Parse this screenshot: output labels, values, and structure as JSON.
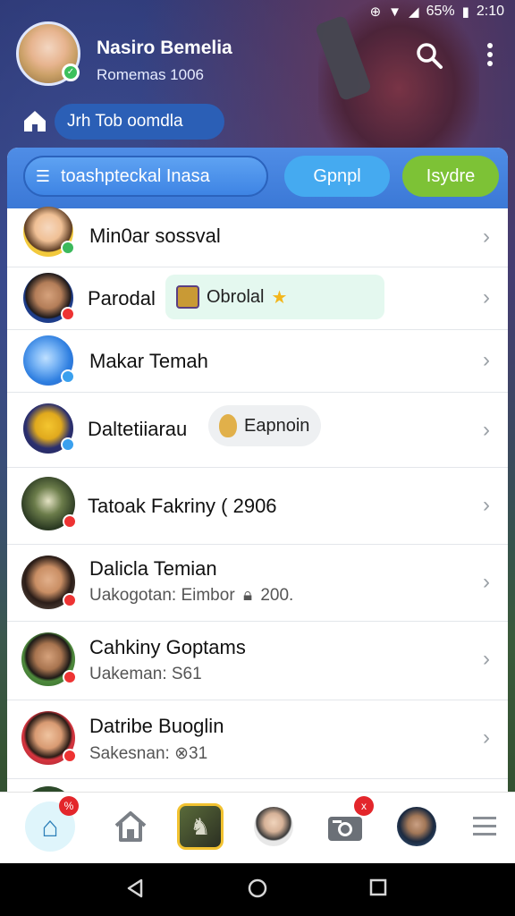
{
  "status": {
    "battery": "65%",
    "time": "2:10"
  },
  "header": {
    "user_name": "Nasiro Bemelia",
    "user_subtitle": "Romemas 1006",
    "chip_label": "Jrh Tob oomdla"
  },
  "toolbar": {
    "search_pill_label": "toashpteckal Inasa",
    "group_button": "Gpnpl",
    "share_button": "Isydre"
  },
  "rows": [
    {
      "title": "Min0ar sossval",
      "subtitle": ""
    },
    {
      "title": "Parodal",
      "tag": "Obrolal"
    },
    {
      "title": "Makar Temah",
      "subtitle": ""
    },
    {
      "title": "Daltetiiarau",
      "tag": "Eapnoin"
    },
    {
      "title": "Tatoak Fakriny ( 2906",
      "subtitle": ""
    },
    {
      "title": "Dalicla Temian",
      "subtitle": "Uakogotan: Eimbor",
      "subtitle_value": "200."
    },
    {
      "title": "Cahkiny Goptams",
      "subtitle": "Uakeman: S61"
    },
    {
      "title": "Datribe Buoglin",
      "subtitle": "Sakesnan: ",
      "subtitle_value": "31"
    }
  ],
  "bottom_nav": {
    "badge_first": "%",
    "badge_camera": "x"
  },
  "colors": {
    "toolbar": "#3b78d6",
    "group_button": "#45aaf0",
    "share_button": "#7dc236",
    "badge_red": "#e3262b"
  }
}
